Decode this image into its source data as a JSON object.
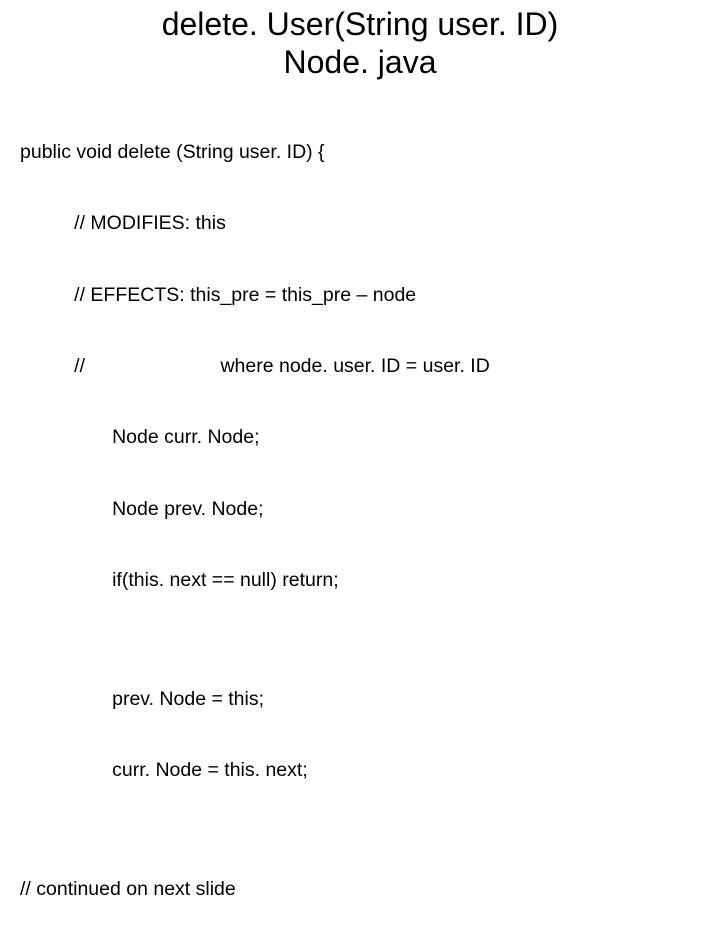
{
  "title_line_1": "delete. User(String user. ID)",
  "title_line_2": "Node. java",
  "code_lines": [
    "public void delete (String user. ID) {",
    "          // MODIFIES: this",
    "          // EFFECTS: this_pre = this_pre – node",
    "          //                         where node. user. ID = user. ID",
    "                 Node curr. Node;",
    "                 Node prev. Node;",
    "                 if(this. next == null) return;",
    "",
    "                 prev. Node = this;",
    "                 curr. Node = this. next;",
    "",
    "// continued on next slide"
  ]
}
